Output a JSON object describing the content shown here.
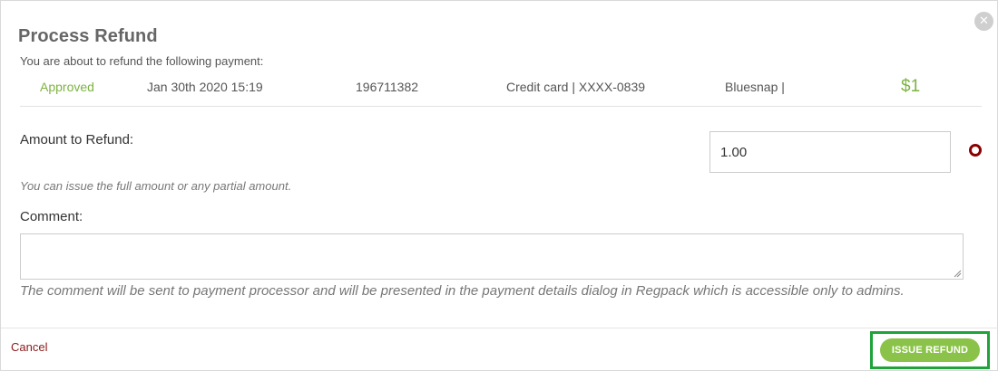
{
  "dialog": {
    "title": "Process Refund",
    "subtitle": "You are about to refund the following payment:",
    "close_icon": "close-icon"
  },
  "payment": {
    "status": "Approved",
    "date": "Jan 30th 2020 15:19",
    "id": "196711382",
    "method": "Credit card | XXXX-0839",
    "gateway": "Bluesnap |",
    "amount": "$1"
  },
  "refund": {
    "amount_label": "Amount to Refund:",
    "amount_value": "1.00",
    "amount_hint": "You can issue the full amount or any partial amount.",
    "comment_label": "Comment:",
    "comment_value": "",
    "comment_hint": "The comment will be sent to payment processor and will be presented in the payment details dialog in Regpack which is accessible only to admins."
  },
  "footer": {
    "cancel_label": "Cancel",
    "issue_label": "ISSUE REFUND"
  },
  "colors": {
    "accent_green": "#8bc34a",
    "status_green": "#7cb342",
    "cancel_red": "#8b1a1a",
    "required_red": "#8b0000",
    "highlight_green": "#1fa33a"
  }
}
